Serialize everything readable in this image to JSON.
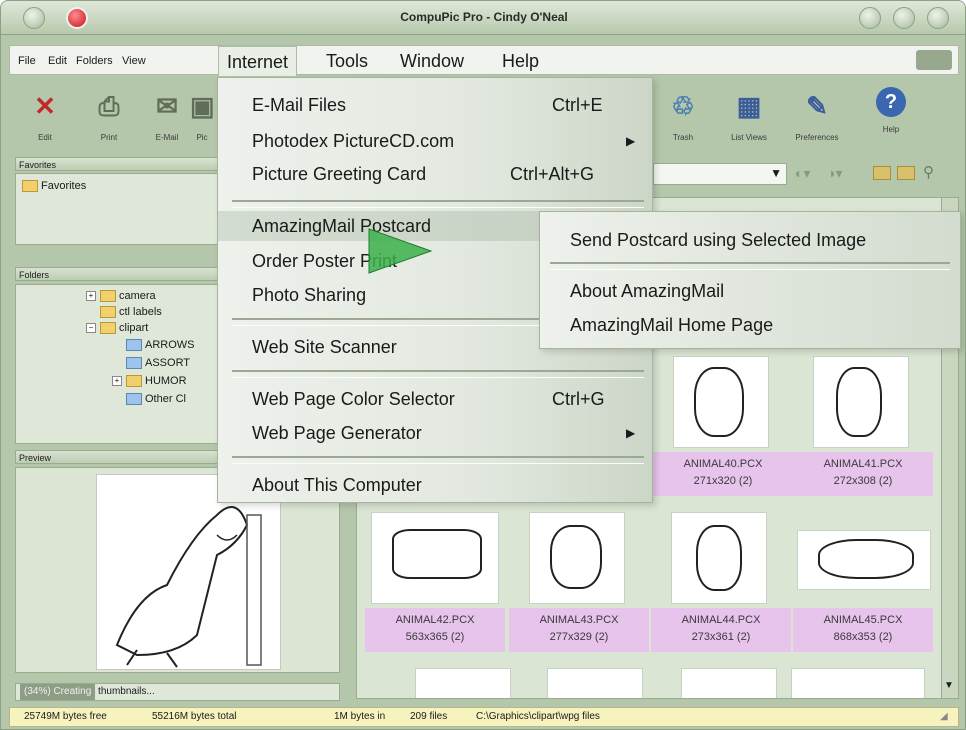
{
  "window": {
    "title": "CompuPic Pro - Cindy O'Neal"
  },
  "menubar": {
    "items": [
      "File",
      "Edit",
      "Folders",
      "View"
    ],
    "open_items": [
      "Internet",
      "Tools",
      "Window",
      "Help"
    ]
  },
  "toolbar": {
    "left": [
      {
        "label": "Edit",
        "icon": "edit-x-icon"
      },
      {
        "label": "Print",
        "icon": "printer-icon"
      },
      {
        "label": "E-Mail",
        "icon": "email-icon"
      },
      {
        "label": "Pic",
        "icon": "picture-icon"
      }
    ],
    "right": [
      {
        "label": "Trash",
        "icon": "trash-icon"
      },
      {
        "label": "List Views",
        "icon": "list-views-icon"
      },
      {
        "label": "Preferences",
        "icon": "preferences-icon"
      },
      {
        "label": "Help",
        "icon": "help-icon"
      }
    ]
  },
  "favorites": {
    "header": "Favorites",
    "item": "Favorites"
  },
  "folders": {
    "header": "Folders",
    "items": [
      "camera",
      "ctl labels",
      "clipart",
      "ARROWS",
      "ASSORT",
      "HUMOR",
      "Other Cl"
    ]
  },
  "preview": {
    "header": "Preview"
  },
  "progress": {
    "percent_label": "(34%) Creating",
    "text": "thumbnails..."
  },
  "menu": {
    "items": [
      {
        "label": "E-Mail Files",
        "shortcut": "Ctrl+E"
      },
      {
        "label": "Photodex PictureCD.com",
        "shortcut": "",
        "submenu": true
      },
      {
        "label": "Picture Greeting Card",
        "shortcut": "Ctrl+Alt+G"
      },
      {
        "label": "AmazingMail Postcard",
        "shortcut": "",
        "submenu": true,
        "highlighted": true
      },
      {
        "label": "Order Poster Print",
        "shortcut": ""
      },
      {
        "label": "Photo Sharing",
        "shortcut": ""
      },
      {
        "label": "Web Site Scanner",
        "shortcut": ""
      },
      {
        "label": "Web Page Color Selector",
        "shortcut": "Ctrl+G"
      },
      {
        "label": "Web Page Generator",
        "shortcut": "",
        "submenu": true
      },
      {
        "label": "About This Computer",
        "shortcut": ""
      }
    ]
  },
  "submenu": {
    "items": [
      "Send Postcard using Selected Image",
      "About AmazingMail",
      "AmazingMail Home Page"
    ]
  },
  "thumbnails": [
    {
      "name": "ANIMAL40.PCX",
      "info": "271x320 (2)"
    },
    {
      "name": "ANIMAL41.PCX",
      "info": "272x308 (2)"
    },
    {
      "name": "ANIMAL42.PCX",
      "info": "563x365 (2)"
    },
    {
      "name": "ANIMAL43.PCX",
      "info": "277x329 (2)"
    },
    {
      "name": "ANIMAL44.PCX",
      "info": "273x361 (2)"
    },
    {
      "name": "ANIMAL45.PCX",
      "info": "868x353 (2)"
    }
  ],
  "statusbar": {
    "free": "25749M bytes free",
    "total": "55216M bytes total",
    "in_files": "1M bytes in",
    "files": "209 files",
    "path": "C:\\Graphics\\clipart\\wpg files"
  },
  "colors": {
    "window_bg": "#b5c7ab",
    "caption_bg": "#e6c4ec",
    "status_bg": "#f6f3bf",
    "cursor": "#3bb04a"
  }
}
